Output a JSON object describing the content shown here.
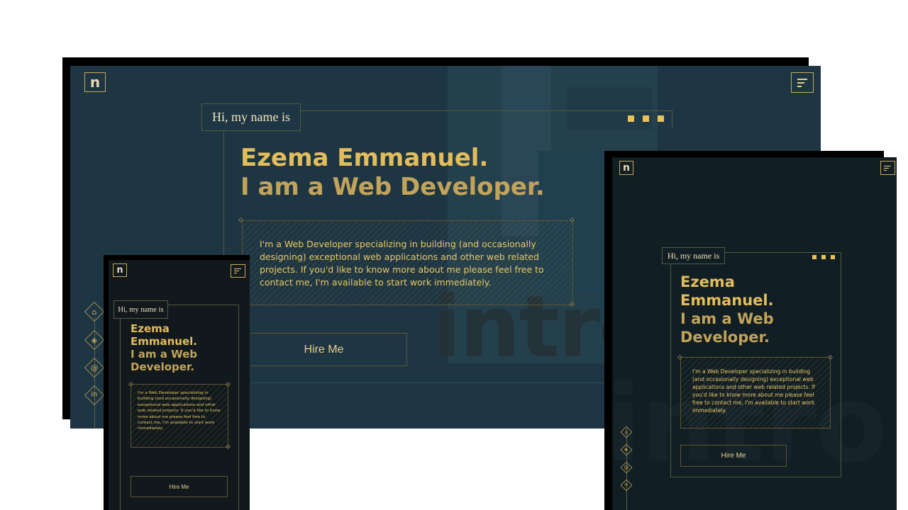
{
  "brand": {
    "logo_letter": "n"
  },
  "intro": {
    "greeting": "Hi, my name is",
    "name": "Ezema Emmanuel.",
    "name_line1": "Ezema",
    "name_line2": "Emmanuel.",
    "role": "I am a Web Developer.",
    "role_line1": "I am a Web",
    "role_line2": "Developer.",
    "description": "I'm a Web Developer specializing in building (and occasionally designing) exceptional web applications and other web related projects. If you'd like to know more about me please feel free to contact me, I'm available to start work immediately.",
    "hire_label": "Hire Me",
    "watermark": "intro."
  },
  "social": [
    {
      "name": "github",
      "glyph": "⌂"
    },
    {
      "name": "codepen",
      "glyph": "◈"
    },
    {
      "name": "email",
      "glyph": "@"
    },
    {
      "name": "linkedin",
      "glyph": "in"
    }
  ],
  "colors": {
    "desktop_bg": "#1e3643",
    "tablet_bg": "#111e23",
    "mobile_bg": "#11191d",
    "accent": "#e3bd5b",
    "accent_dim": "#c2a35a"
  }
}
